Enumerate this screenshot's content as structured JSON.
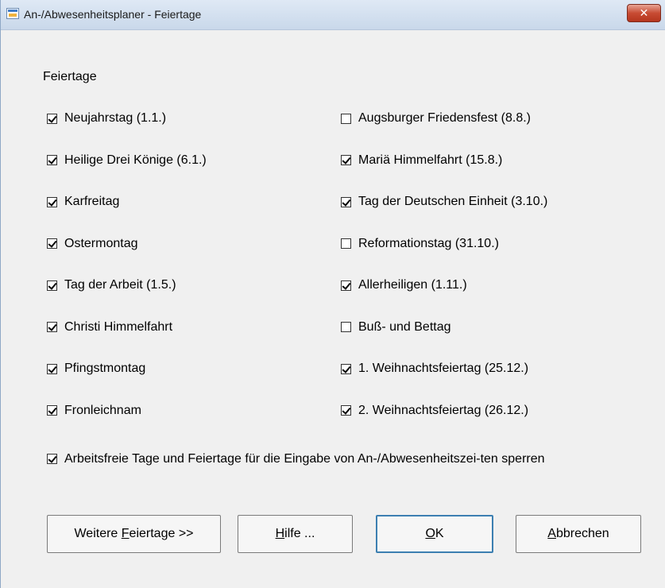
{
  "window": {
    "title": "An-/Abwesenheitsplaner - Feiertage",
    "close_label": "✕"
  },
  "group_label": "Feiertage",
  "left_column": [
    {
      "label": "Neujahrstag (1.1.)",
      "checked": true
    },
    {
      "label": "Heilige Drei Könige (6.1.)",
      "checked": true
    },
    {
      "label": "Karfreitag",
      "checked": true
    },
    {
      "label": "Ostermontag",
      "checked": true
    },
    {
      "label": "Tag der Arbeit (1.5.)",
      "checked": true
    },
    {
      "label": "Christi Himmelfahrt",
      "checked": true
    },
    {
      "label": "Pfingstmontag",
      "checked": true
    },
    {
      "label": "Fronleichnam",
      "checked": true
    }
  ],
  "right_column": [
    {
      "label": "Augsburger Friedensfest (8.8.)",
      "checked": false
    },
    {
      "label": "Mariä Himmelfahrt (15.8.)",
      "checked": true
    },
    {
      "label": "Tag der Deutschen Einheit (3.10.)",
      "checked": true
    },
    {
      "label": "Reformationstag (31.10.)",
      "checked": false
    },
    {
      "label": "Allerheiligen (1.11.)",
      "checked": true
    },
    {
      "label": "Buß- und Bettag",
      "checked": false
    },
    {
      "label": "1. Weihnachtsfeiertag (25.12.)",
      "checked": true
    },
    {
      "label": "2. Weihnachtsfeiertag (26.12.)",
      "checked": true
    }
  ],
  "lock_option": {
    "label": "Arbeitsfreie Tage und Feiertage für die Eingabe von An-/Abwesenheitszei-ten sperren",
    "checked": true
  },
  "buttons": {
    "more_holidays": {
      "before": "Weitere ",
      "mnemonic": "F",
      "after": "eiertage >>"
    },
    "help": {
      "before": "",
      "mnemonic": "H",
      "after": "ilfe ..."
    },
    "ok": {
      "before": "",
      "mnemonic": "O",
      "after": "K"
    },
    "cancel": {
      "before": "",
      "mnemonic": "A",
      "after": "bbrechen"
    }
  },
  "colors": {
    "title_bar": "#c9d8ea",
    "close_button": "#c84b33",
    "client_bg": "#f0f0f0",
    "default_button_border": "#3c7fb1"
  },
  "icons": {
    "app": "calendar-window-icon",
    "close": "close-icon",
    "checkmark": "checkmark-icon"
  }
}
